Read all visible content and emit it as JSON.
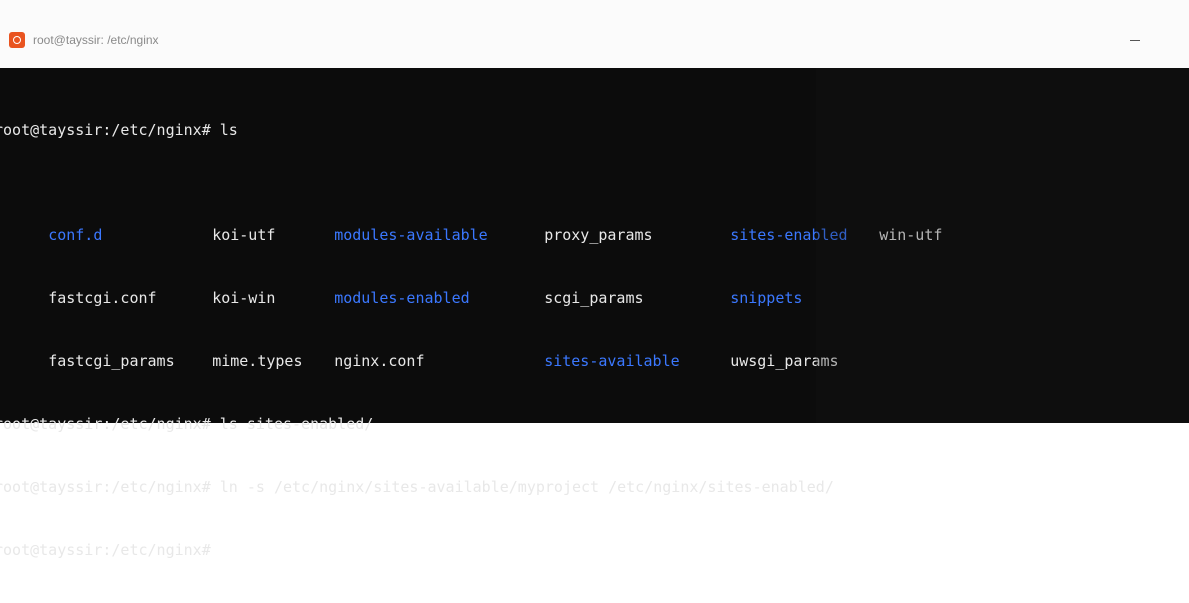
{
  "window": {
    "title": "root@tayssir: /etc/nginx",
    "icon": "ubuntu-terminal-icon",
    "minimize_icon": "minimize-icon"
  },
  "colors": {
    "background": "#0c0c0c",
    "text": "#e8e8e8",
    "directory": "#3b78ff",
    "app_icon": "#e95420"
  },
  "terminal": {
    "prompt1": "root@tayssir:/etc/nginx# ls",
    "ls_rows": [
      [
        {
          "name": "conf.d",
          "type": "dir"
        },
        {
          "name": "koi-utf",
          "type": "file"
        },
        {
          "name": "modules-available",
          "type": "dir"
        },
        {
          "name": "proxy_params",
          "type": "file"
        },
        {
          "name": "sites-enabled",
          "type": "dir"
        },
        {
          "name": "win-utf",
          "type": "file"
        }
      ],
      [
        {
          "name": "fastcgi.conf",
          "type": "file"
        },
        {
          "name": "koi-win",
          "type": "file"
        },
        {
          "name": "modules-enabled",
          "type": "dir"
        },
        {
          "name": "scgi_params",
          "type": "file"
        },
        {
          "name": "snippets",
          "type": "dir"
        },
        {
          "name": "",
          "type": "file"
        }
      ],
      [
        {
          "name": "fastcgi_params",
          "type": "file"
        },
        {
          "name": "mime.types",
          "type": "file"
        },
        {
          "name": "nginx.conf",
          "type": "file"
        },
        {
          "name": "sites-available",
          "type": "dir"
        },
        {
          "name": "uwsgi_params",
          "type": "file"
        },
        {
          "name": "",
          "type": "file"
        }
      ]
    ],
    "prompt2": "root@tayssir:/etc/nginx# ls sites-enabled/",
    "prompt3": "root@tayssir:/etc/nginx# ln -s /etc/nginx/sites-available/myproject /etc/nginx/sites-enabled/",
    "prompt4": "root@tayssir:/etc/nginx#"
  }
}
